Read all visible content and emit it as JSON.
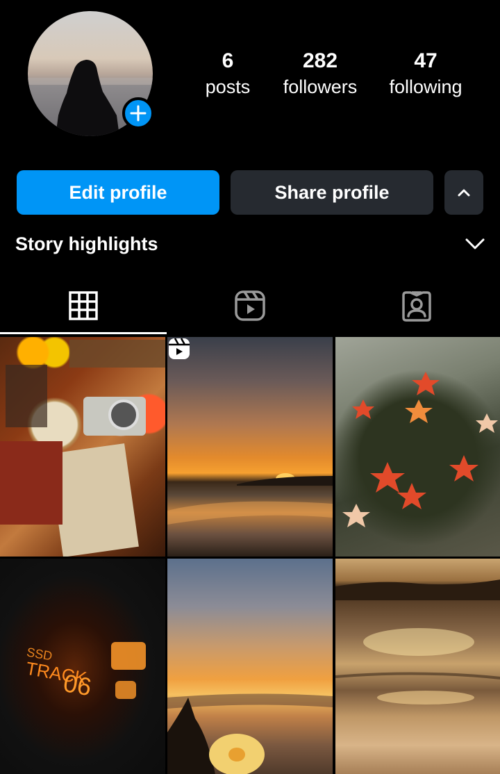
{
  "profile": {
    "stats": {
      "posts": {
        "value": "6",
        "label": "posts"
      },
      "followers": {
        "value": "282",
        "label": "followers"
      },
      "following": {
        "value": "47",
        "label": "following"
      }
    }
  },
  "actions": {
    "edit_label": "Edit profile",
    "share_label": "Share profile",
    "more_icon": "chevron-up-icon"
  },
  "highlights": {
    "title": "Story highlights",
    "toggle_icon": "chevron-down-icon"
  },
  "tabs": [
    {
      "name": "posts-grid",
      "icon": "grid-icon",
      "active": true
    },
    {
      "name": "reels",
      "icon": "reels-icon",
      "active": false
    },
    {
      "name": "tagged",
      "icon": "tagged-icon",
      "active": false
    }
  ],
  "posts": [
    {
      "subject": "candles, camera and photos on table",
      "is_reel": false
    },
    {
      "subject": "sunset over beach",
      "is_reel": true
    },
    {
      "subject": "starfish in tide pool",
      "is_reel": false
    },
    {
      "subject": "glowing TRACK 06 display in dark",
      "is_reel": false,
      "display_text": {
        "line1": "SSD",
        "line2": "TRACK",
        "track_number": "06"
      }
    },
    {
      "subject": "sunset with flower in hand",
      "is_reel": false
    },
    {
      "subject": "golden sea with sun reflection",
      "is_reel": false
    }
  ],
  "colors": {
    "background": "#000000",
    "accent": "#0095f6",
    "secondary_button": "#262a30",
    "text": "#ffffff"
  }
}
